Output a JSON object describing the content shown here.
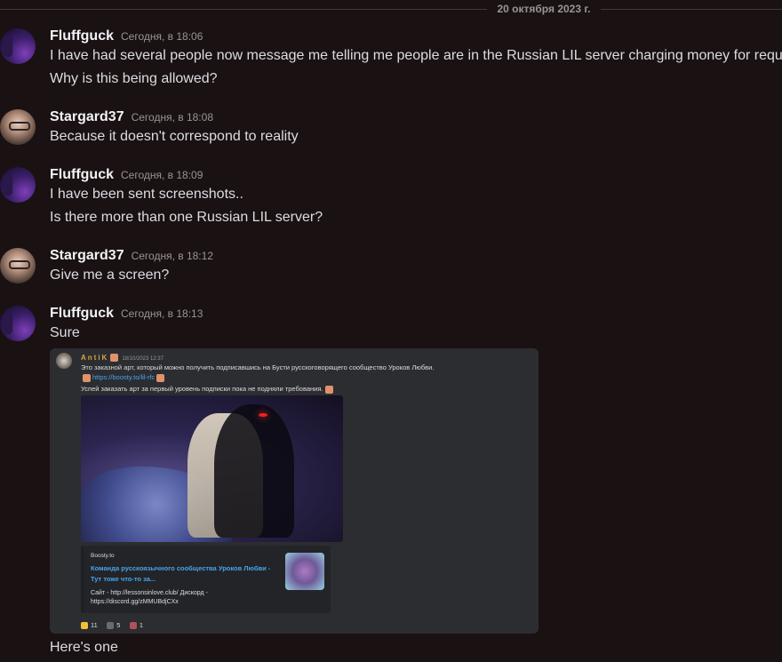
{
  "date_divider": "20 октября 2023 г.",
  "messages": [
    {
      "author": "Fluffguck",
      "timestamp": "Сегодня, в 18:06",
      "lines": [
        "I have had several people now message me telling me people are in the Russian LIL server charging money for requests",
        "Why is this being allowed?"
      ]
    },
    {
      "author": "Stargard37",
      "timestamp": "Сегодня, в 18:08",
      "lines": [
        "Because it doesn't correspond to reality"
      ]
    },
    {
      "author": "Fluffguck",
      "timestamp": "Сегодня, в 18:09",
      "lines": [
        "I have been sent screenshots..",
        "Is there more than one Russian LIL server?"
      ]
    },
    {
      "author": "Stargard37",
      "timestamp": "Сегодня, в 18:12",
      "lines": [
        "Give me a screen?"
      ]
    },
    {
      "author": "Fluffguck",
      "timestamp": "Сегодня, в 18:13",
      "lines": [
        "Sure",
        "Here's one"
      ]
    }
  ],
  "screenshot_embed": {
    "author": "AntiK",
    "timestamp": "18/10/2023 12:37",
    "line1": "Это заказной арт, который можно получить подписавшись на Бусти русскоговорящего сообщество Уроков Любви.",
    "link": "https://boosty.to/lil-rfc",
    "line3": "Успей заказать арт за первый уровень подписки пока не подняли требования.",
    "card": {
      "site": "Boosty.to",
      "title": "Команда русскоязычного сообщества Уроков Любви - Тут тоже что-то за...",
      "desc": "Сайт - http://lessonsinlove.club/ Дискорд - https://discord.gg/zMMUBdjCXx"
    },
    "reactions": [
      {
        "icon": "thumbs-up-icon",
        "count": "11"
      },
      {
        "icon": "figure-icon",
        "count": "5"
      },
      {
        "icon": "figure-red-icon",
        "count": "1"
      }
    ]
  }
}
